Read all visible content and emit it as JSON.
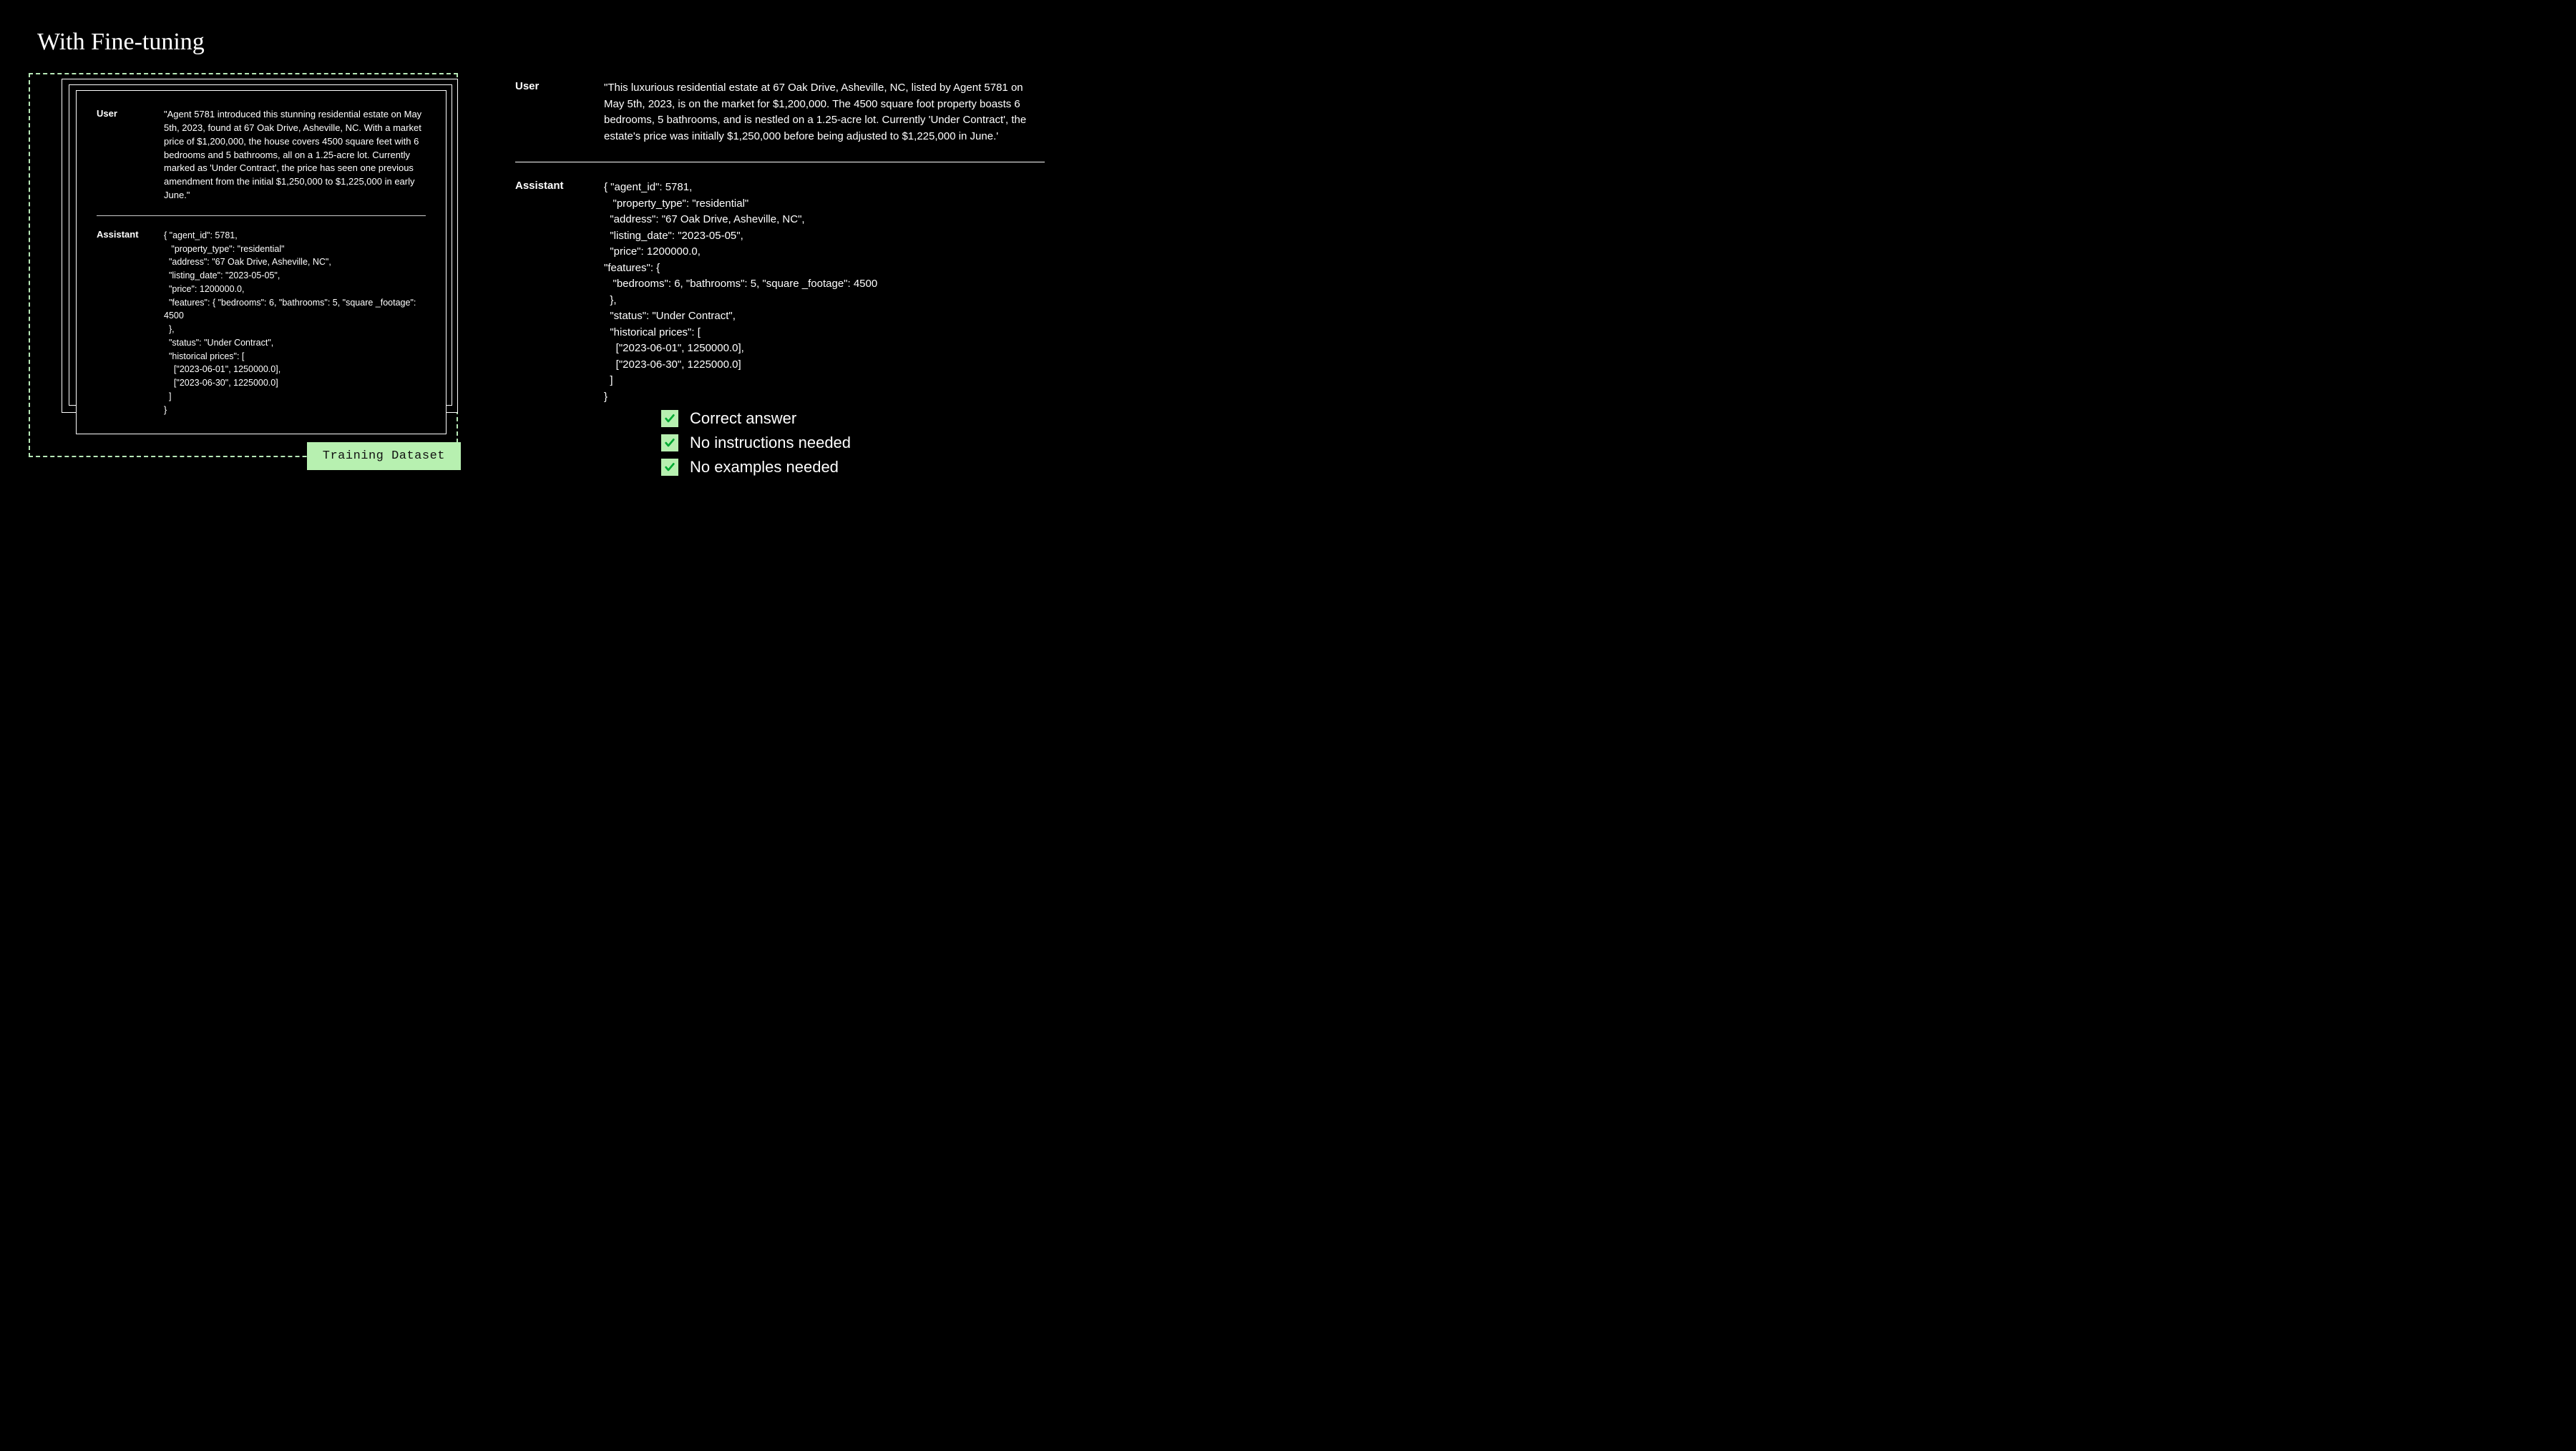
{
  "title": "With Fine-tuning",
  "trainingDatasetLabel": "Training Dataset",
  "leftExample": {
    "userLabel": "User",
    "userText": "\"Agent 5781 introduced this stunning residential estate on May 5th, 2023, found at 67 Oak Drive, Asheville, NC. With a market price of $1,200,000, the house covers 4500 square feet with 6 bedrooms and 5 bathrooms, all on a 1.25-acre lot. Currently marked as 'Under Contract', the price has seen one previous amendment from the initial $1,250,000 to $1,225,000 in early June.\"",
    "assistantLabel": "Assistant",
    "assistantText": "{ \"agent_id\": 5781,\n   \"property_type\": \"residential\"\n  \"address\": \"67 Oak Drive, Asheville, NC\",\n  \"listing_date\": \"2023-05-05\",\n  \"price\": 1200000.0,\n  \"features\": { \"bedrooms\": 6, \"bathrooms\": 5, \"square _footage\": 4500\n  },\n  \"status\": \"Under Contract\",\n  \"historical prices\": [\n    [\"2023-06-01\", 1250000.0],\n    [\"2023-06-30\", 1225000.0]\n  ]\n}"
  },
  "rightExample": {
    "userLabel": "User",
    "userText": "\"This luxurious residential estate at 67 Oak Drive, Asheville, NC, listed by Agent 5781 on May 5th, 2023, is on the market for $1,200,000. The 4500 square foot property boasts 6 bedrooms, 5 bathrooms, and is nestled on a 1.25-acre lot. Currently 'Under Contract', the estate's price was initially $1,250,000 before being adjusted to $1,225,000 in June.'",
    "assistantLabel": "Assistant",
    "assistantText": "{ \"agent_id\": 5781,\n   \"property_type\": \"residential\"\n  \"address\": \"67 Oak Drive, Asheville, NC\",\n  \"listing_date\": \"2023-05-05\",\n  \"price\": 1200000.0,\n\"features\": {\n   \"bedrooms\": 6, \"bathrooms\": 5, \"square _footage\": 4500\n  },\n  \"status\": \"Under Contract\",\n  \"historical prices\": [\n    [\"2023-06-01\", 1250000.0],\n    [\"2023-06-30\", 1225000.0]\n  ]\n}"
  },
  "checks": {
    "item1": "Correct answer",
    "item2": "No instructions needed",
    "item3": "No examples needed"
  }
}
